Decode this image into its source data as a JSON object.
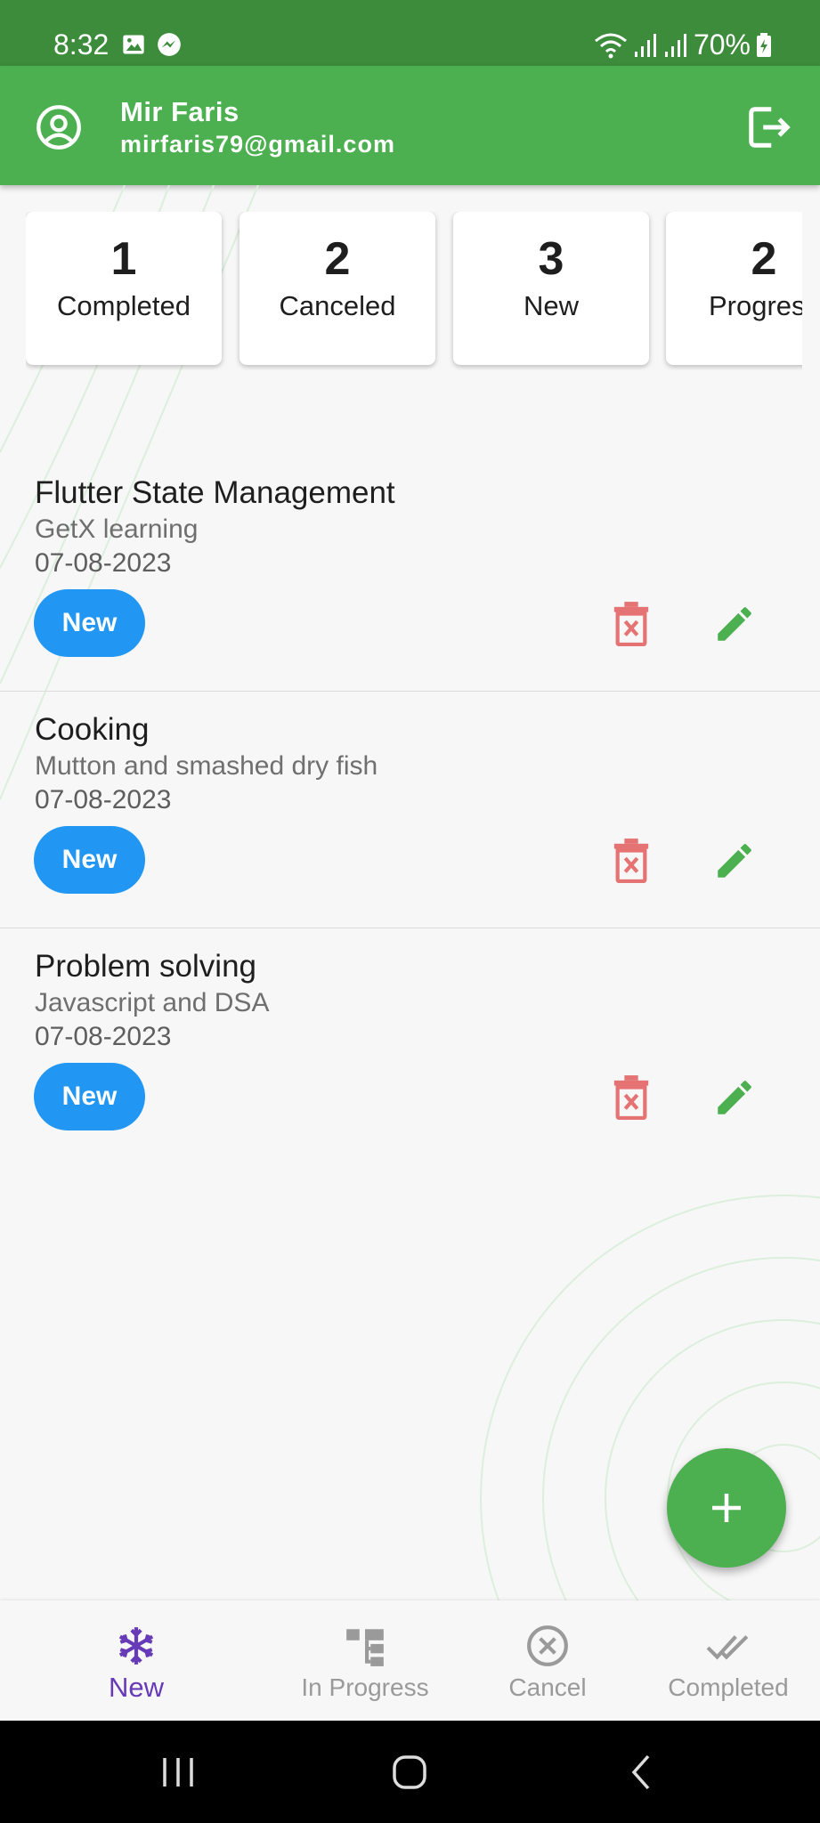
{
  "status_bar": {
    "time": "8:32",
    "battery": "70%",
    "icons": [
      "gallery-icon",
      "messenger-icon",
      "wifi-icon",
      "signal-icon",
      "signal-icon",
      "battery-icon"
    ]
  },
  "header": {
    "name": "Mir Faris",
    "email": "mirfaris79@gmail.com",
    "icons": [
      "account-circle-icon",
      "logout-icon"
    ]
  },
  "summary": [
    {
      "count": "1",
      "label": "Completed"
    },
    {
      "count": "2",
      "label": "Canceled"
    },
    {
      "count": "3",
      "label": "New"
    },
    {
      "count": "2",
      "label": "Progress"
    }
  ],
  "tasks": [
    {
      "title": "Flutter State Management",
      "description": "GetX learning",
      "date": "07-08-2023",
      "status": "New"
    },
    {
      "title": "Cooking",
      "description": "Mutton and smashed dry fish",
      "date": "07-08-2023",
      "status": "New"
    },
    {
      "title": "Problem solving",
      "description": "Javascript and DSA",
      "date": "07-08-2023",
      "status": "New"
    }
  ],
  "bottom_nav": {
    "items": [
      {
        "label": "New",
        "icon": "snowflake-icon",
        "active": true
      },
      {
        "label": "In Progress",
        "icon": "hierarchy-icon",
        "active": false
      },
      {
        "label": "Cancel",
        "icon": "cancel-circle-icon",
        "active": false
      },
      {
        "label": "Completed",
        "icon": "done-all-icon",
        "active": false
      }
    ]
  },
  "colors": {
    "primary": "#4caf50",
    "status_bar": "#3c8c3c",
    "badge": "#2196f3",
    "delete": "#e57373",
    "active_nav": "#673ab7"
  }
}
